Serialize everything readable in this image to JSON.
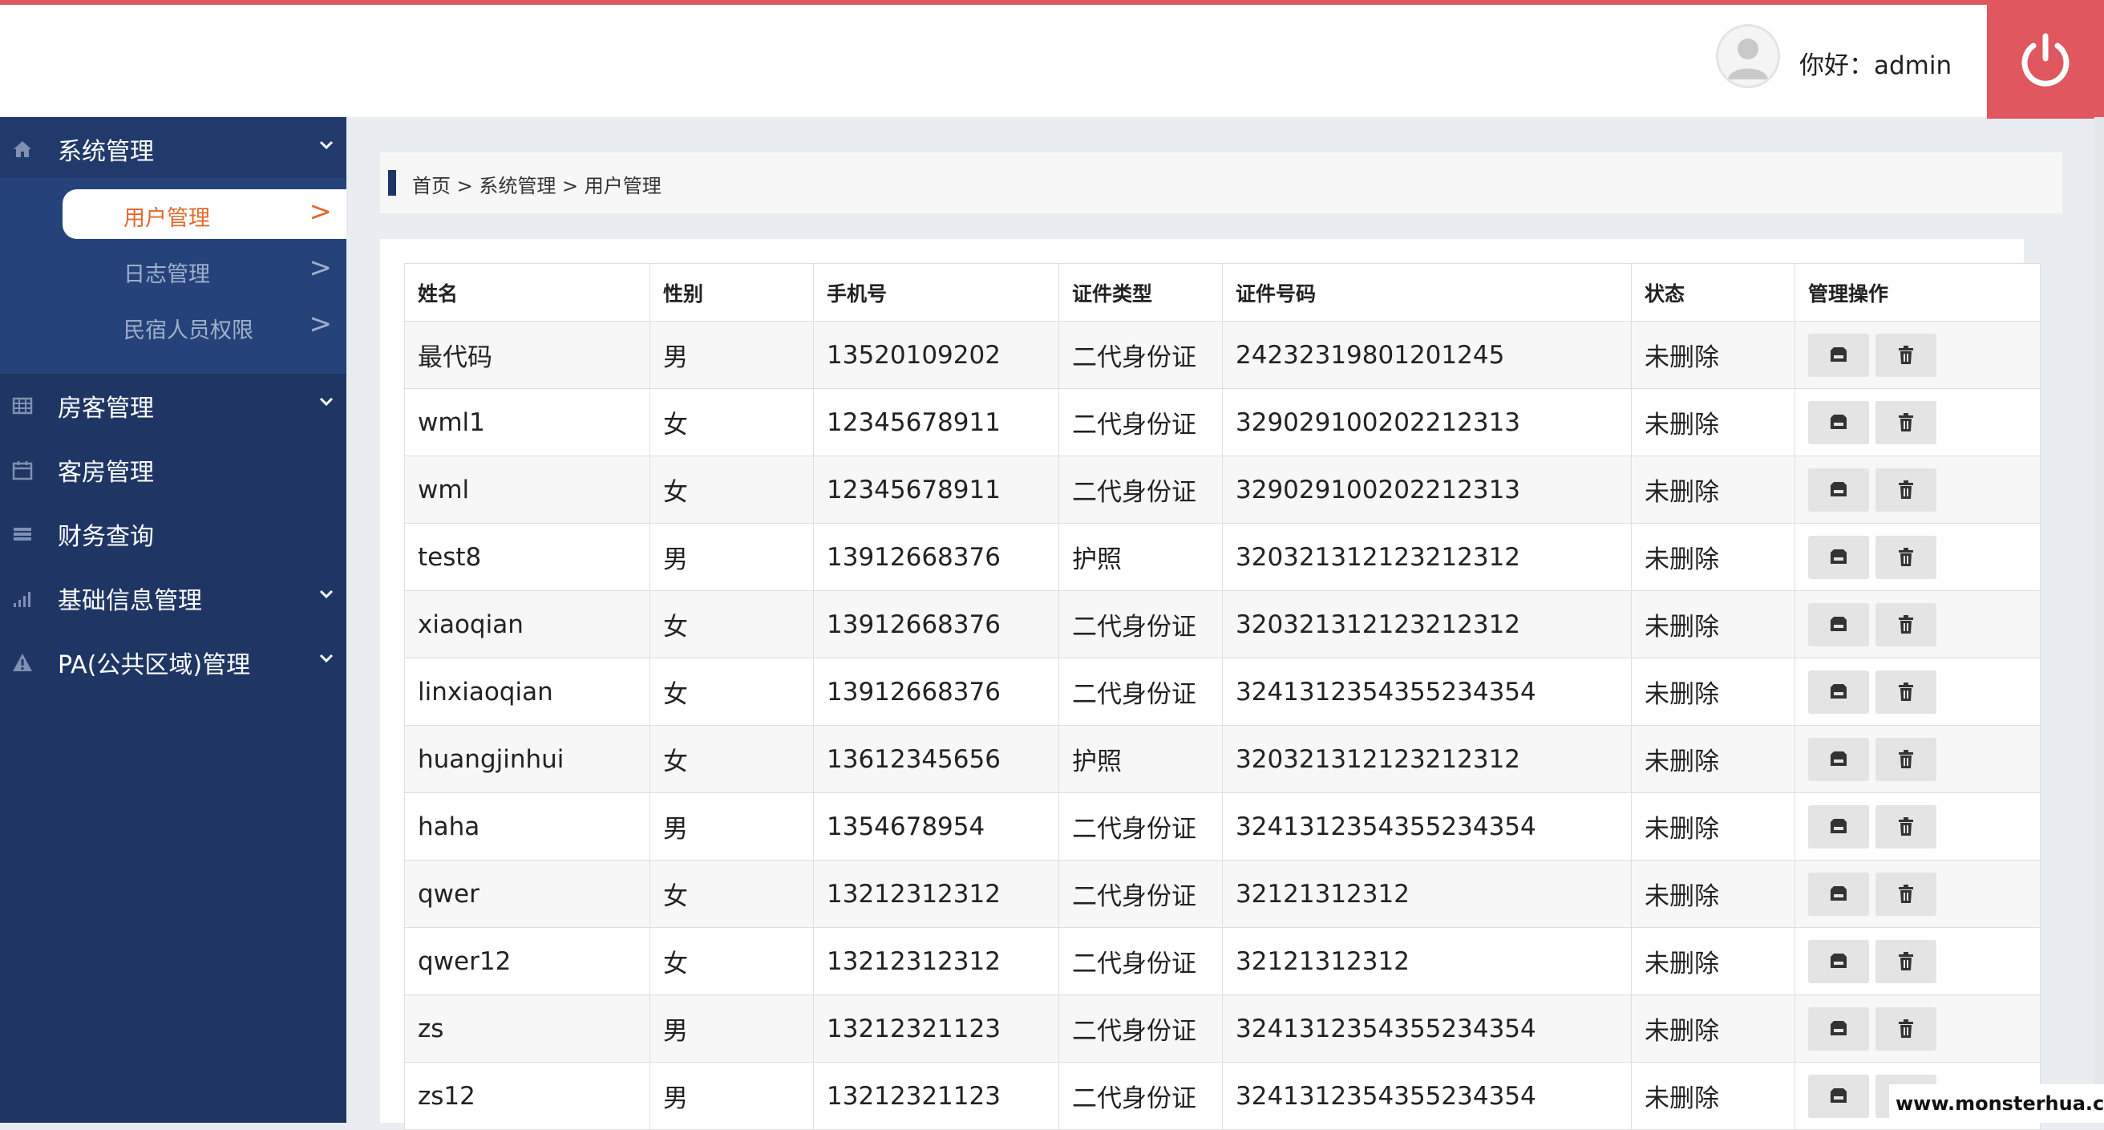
{
  "header": {
    "greeting": "你好：admin"
  },
  "sidebar": {
    "groups": [
      {
        "label": "系统管理",
        "icon": "home-icon",
        "has_chevron": true,
        "expanded": true
      },
      {
        "label": "房客管理",
        "icon": "grid-icon",
        "has_chevron": true
      },
      {
        "label": "客房管理",
        "icon": "calendar-icon",
        "has_chevron": false
      },
      {
        "label": "财务查询",
        "icon": "list-icon",
        "has_chevron": false
      },
      {
        "label": "基础信息管理",
        "icon": "signal-icon",
        "has_chevron": true
      },
      {
        "label": "PA(公共区域)管理",
        "icon": "warning-icon",
        "has_chevron": true
      }
    ],
    "submenu": [
      {
        "label": "用户管理",
        "active": true
      },
      {
        "label": "日志管理",
        "active": false
      },
      {
        "label": "民宿人员权限",
        "active": false
      }
    ],
    "sub_arrow": ">"
  },
  "breadcrumb": {
    "text": "首页 >  系统管理 >  用户管理"
  },
  "table": {
    "headers": [
      "姓名",
      "性别",
      "手机号",
      "证件类型",
      "证件号码",
      "状态",
      "管理操作"
    ],
    "rows": [
      [
        "最代码",
        "男",
        "13520109202",
        "二代身份证",
        "24232319801201245",
        "未删除"
      ],
      [
        "wml1",
        "女",
        "12345678911",
        "二代身份证",
        "329029100202212313",
        "未删除"
      ],
      [
        "wml",
        "女",
        "12345678911",
        "二代身份证",
        "329029100202212313",
        "未删除"
      ],
      [
        "test8",
        "男",
        "13912668376",
        "护照",
        "320321312123212312",
        "未删除"
      ],
      [
        "xiaoqian",
        "女",
        "13912668376",
        "二代身份证",
        "320321312123212312",
        "未删除"
      ],
      [
        "linxiaoqian",
        "女",
        "13912668376",
        "二代身份证",
        "324131235435523435​4",
        "未删除"
      ],
      [
        "huangjinhui",
        "女",
        "13612345656",
        "护照",
        "320321312123212312",
        "未删除"
      ],
      [
        "haha",
        "男",
        "1354678954",
        "二代身份证",
        "3241312354355234354",
        "未删除"
      ],
      [
        "qwer",
        "女",
        "13212312312",
        "二代身份证",
        "32121312312",
        "未删除"
      ],
      [
        "qwer12",
        "女",
        "13212312312",
        "二代身份证",
        "32121312312",
        "未删除"
      ],
      [
        "zs",
        "男",
        "13212321123",
        "二代身份证",
        "3241312354355234354",
        "未删除"
      ],
      [
        "zs12",
        "男",
        "13212321123",
        "二代身份证",
        "3241312354355234354",
        "未删除"
      ]
    ],
    "actions": [
      "edit-icon",
      "trash-icon"
    ]
  },
  "watermark": "www.monsterhua.com",
  "colors": {
    "accent_red": "#e0575f",
    "sidebar_bg": "#1f3665",
    "submenu_bg": "#25437a",
    "active_text": "#e06a2e"
  }
}
